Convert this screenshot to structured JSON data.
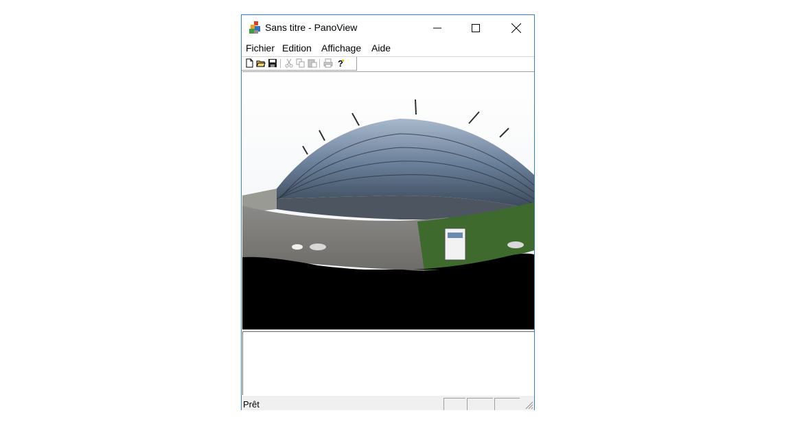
{
  "window": {
    "title": "Sans titre - PanoView",
    "icon": "panoview-app-icon",
    "accent_color": "#2b7fd6"
  },
  "menu": {
    "items": [
      "Fichier",
      "Edition",
      "Affichage",
      "Aide"
    ]
  },
  "toolbar": {
    "buttons": [
      "new-file-icon",
      "open-folder-icon",
      "save-icon",
      "cut-icon",
      "copy-icon",
      "paste-icon",
      "print-icon",
      "help-icon"
    ]
  },
  "status": {
    "text": "Prêt"
  }
}
